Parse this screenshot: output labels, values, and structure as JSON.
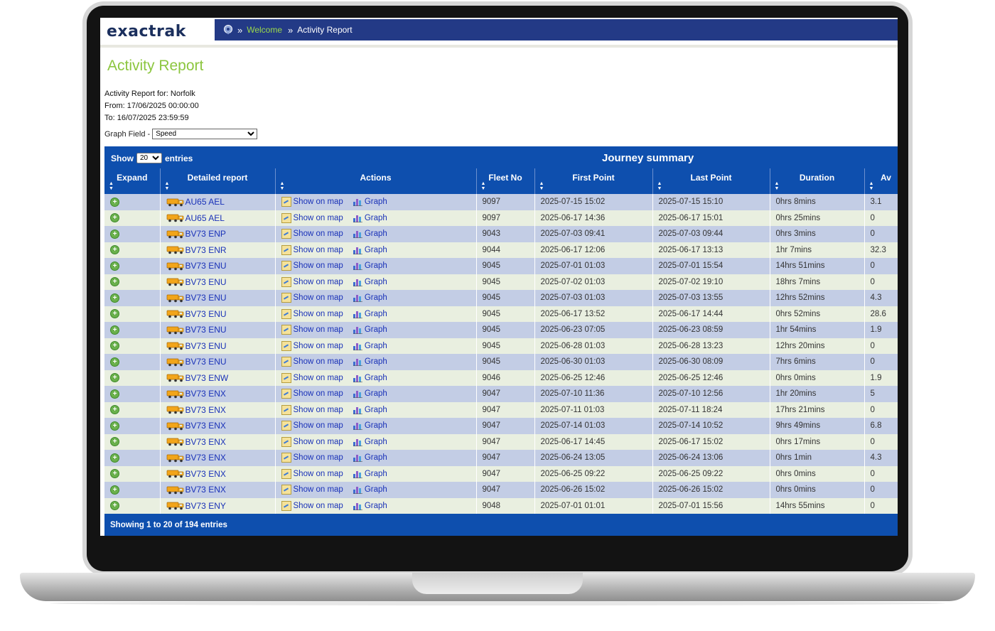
{
  "header": {
    "logo": "exactrak",
    "breadcrumb": {
      "home_icon": "map-pin-icon",
      "sep": "»",
      "welcome": "Welcome",
      "current": "Activity Report"
    }
  },
  "page": {
    "title": "Activity Report",
    "report_for": "Activity Report for: Norfolk",
    "from": "From: 17/06/2025 00:00:00",
    "to": "To: 16/07/2025 23:59:59",
    "graph_field_label": "Graph Field -",
    "graph_field_value": "Speed"
  },
  "table": {
    "show_label": "Show",
    "entries_label": "entries",
    "page_size": "20",
    "heading": "Journey summary",
    "columns": [
      "Expand",
      "Detailed report",
      "Actions",
      "Fleet No",
      "First Point",
      "Last Point",
      "Duration",
      "Av"
    ],
    "show_on_map": "Show on map",
    "graph": "Graph",
    "rows": [
      {
        "vehicle": "AU65 AEL",
        "fleet": "9097",
        "first": "2025-07-15 15:02",
        "last": "2025-07-15 15:10",
        "duration": "0hrs 8mins",
        "av": "3.1"
      },
      {
        "vehicle": "AU65 AEL",
        "fleet": "9097",
        "first": "2025-06-17 14:36",
        "last": "2025-06-17 15:01",
        "duration": "0hrs 25mins",
        "av": "0"
      },
      {
        "vehicle": "BV73 ENP",
        "fleet": "9043",
        "first": "2025-07-03 09:41",
        "last": "2025-07-03 09:44",
        "duration": "0hrs 3mins",
        "av": "0"
      },
      {
        "vehicle": "BV73 ENR",
        "fleet": "9044",
        "first": "2025-06-17 12:06",
        "last": "2025-06-17 13:13",
        "duration": "1hr 7mins",
        "av": "32.3"
      },
      {
        "vehicle": "BV73 ENU",
        "fleet": "9045",
        "first": "2025-07-01 01:03",
        "last": "2025-07-01 15:54",
        "duration": "14hrs 51mins",
        "av": "0"
      },
      {
        "vehicle": "BV73 ENU",
        "fleet": "9045",
        "first": "2025-07-02 01:03",
        "last": "2025-07-02 19:10",
        "duration": "18hrs 7mins",
        "av": "0"
      },
      {
        "vehicle": "BV73 ENU",
        "fleet": "9045",
        "first": "2025-07-03 01:03",
        "last": "2025-07-03 13:55",
        "duration": "12hrs 52mins",
        "av": "4.3"
      },
      {
        "vehicle": "BV73 ENU",
        "fleet": "9045",
        "first": "2025-06-17 13:52",
        "last": "2025-06-17 14:44",
        "duration": "0hrs 52mins",
        "av": "28.6"
      },
      {
        "vehicle": "BV73 ENU",
        "fleet": "9045",
        "first": "2025-06-23 07:05",
        "last": "2025-06-23 08:59",
        "duration": "1hr 54mins",
        "av": "1.9"
      },
      {
        "vehicle": "BV73 ENU",
        "fleet": "9045",
        "first": "2025-06-28 01:03",
        "last": "2025-06-28 13:23",
        "duration": "12hrs 20mins",
        "av": "0"
      },
      {
        "vehicle": "BV73 ENU",
        "fleet": "9045",
        "first": "2025-06-30 01:03",
        "last": "2025-06-30 08:09",
        "duration": "7hrs 6mins",
        "av": "0"
      },
      {
        "vehicle": "BV73 ENW",
        "fleet": "9046",
        "first": "2025-06-25 12:46",
        "last": "2025-06-25 12:46",
        "duration": "0hrs 0mins",
        "av": "1.9"
      },
      {
        "vehicle": "BV73 ENX",
        "fleet": "9047",
        "first": "2025-07-10 11:36",
        "last": "2025-07-10 12:56",
        "duration": "1hr 20mins",
        "av": "5"
      },
      {
        "vehicle": "BV73 ENX",
        "fleet": "9047",
        "first": "2025-07-11 01:03",
        "last": "2025-07-11 18:24",
        "duration": "17hrs 21mins",
        "av": "0"
      },
      {
        "vehicle": "BV73 ENX",
        "fleet": "9047",
        "first": "2025-07-14 01:03",
        "last": "2025-07-14 10:52",
        "duration": "9hrs 49mins",
        "av": "6.8"
      },
      {
        "vehicle": "BV73 ENX",
        "fleet": "9047",
        "first": "2025-06-17 14:45",
        "last": "2025-06-17 15:02",
        "duration": "0hrs 17mins",
        "av": "0"
      },
      {
        "vehicle": "BV73 ENX",
        "fleet": "9047",
        "first": "2025-06-24 13:05",
        "last": "2025-06-24 13:06",
        "duration": "0hrs 1min",
        "av": "4.3"
      },
      {
        "vehicle": "BV73 ENX",
        "fleet": "9047",
        "first": "2025-06-25 09:22",
        "last": "2025-06-25 09:22",
        "duration": "0hrs 0mins",
        "av": "0"
      },
      {
        "vehicle": "BV73 ENX",
        "fleet": "9047",
        "first": "2025-06-26 15:02",
        "last": "2025-06-26 15:02",
        "duration": "0hrs 0mins",
        "av": "0"
      },
      {
        "vehicle": "BV73 ENY",
        "fleet": "9048",
        "first": "2025-07-01 01:01",
        "last": "2025-07-01 15:56",
        "duration": "14hrs 55mins",
        "av": "0"
      }
    ],
    "footer": "Showing 1 to 20 of 194 entries"
  },
  "colors": {
    "brand_blue": "#0e4fae",
    "nav_blue": "#233a86",
    "accent_green": "#8cc63f",
    "row_odd": "#c3cde5",
    "row_even": "#e9efe0"
  }
}
